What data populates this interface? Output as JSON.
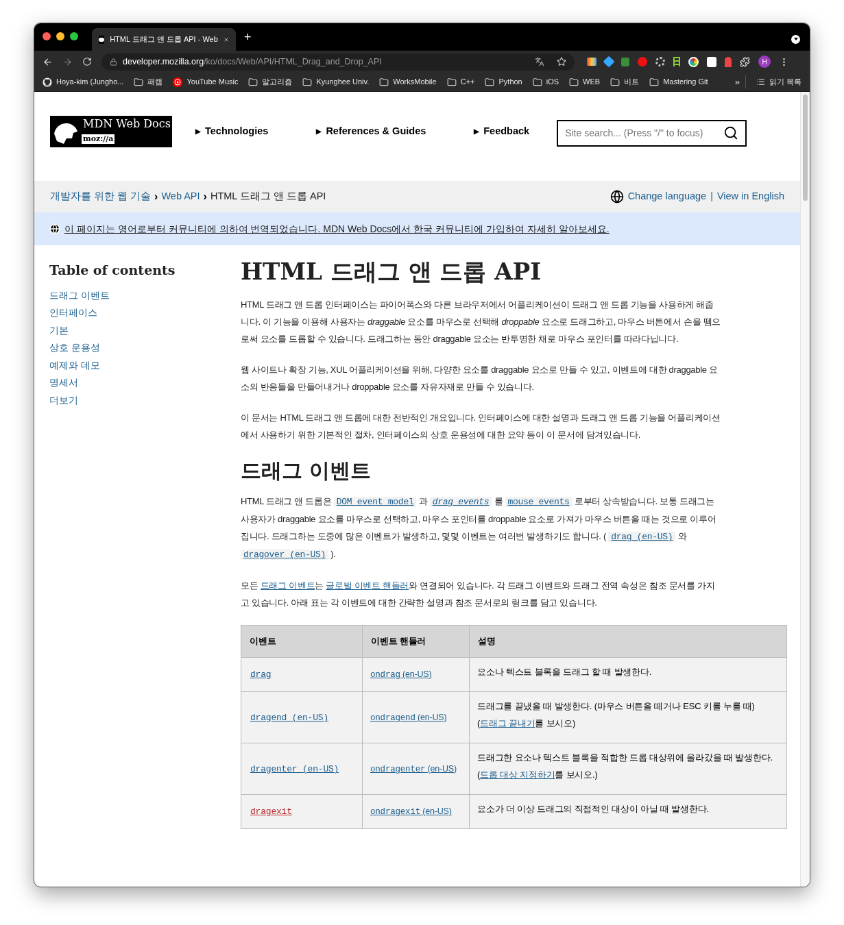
{
  "browser": {
    "tab_title": "HTML 드래그 앤 드롭 API - Web",
    "new_tab": "+",
    "url_host": "developer.mozilla.org",
    "url_path": "/ko/docs/Web/API/HTML_Drag_and_Drop_API",
    "profile": "H",
    "bookmarks": [
      {
        "label": "Hoya-kim (Jungho...",
        "kind": "github"
      },
      {
        "label": "패캠",
        "kind": "folder"
      },
      {
        "label": "YouTube Music",
        "kind": "youtube"
      },
      {
        "label": "알고리즘",
        "kind": "folder"
      },
      {
        "label": "Kyunghee Univ.",
        "kind": "folder"
      },
      {
        "label": "WorksMobile",
        "kind": "folder"
      },
      {
        "label": "C++",
        "kind": "folder"
      },
      {
        "label": "Python",
        "kind": "folder"
      },
      {
        "label": "iOS",
        "kind": "folder"
      },
      {
        "label": "WEB",
        "kind": "folder"
      },
      {
        "label": "비트",
        "kind": "folder"
      },
      {
        "label": "Mastering Git",
        "kind": "folder"
      }
    ],
    "more_bookmarks": "»",
    "reading_list": "읽기 목록"
  },
  "header": {
    "logo_title": "MDN Web Docs",
    "logo_sub": "moz://a",
    "nav": [
      "Technologies",
      "References & Guides",
      "Feedback"
    ],
    "nav_marker": "▶",
    "search": {
      "placeholder": "Site search... (Press \"/\" to focus)"
    }
  },
  "breadcrumbs": {
    "items": [
      "개발자를 위한 웹 기술",
      "Web API",
      "HTML 드래그 앤 드롭 API"
    ],
    "separator": "›",
    "change_language": "Change language",
    "divider": "|",
    "view_english": "View in English"
  },
  "notice": "이 페이지는 영어로부터 커뮤니티에 의하여 번역되었습니다. MDN Web Docs에서 한국 커뮤니티에 가입하여 자세히 알아보세요.",
  "toc": {
    "title": "Table of contents",
    "items": [
      "드래그 이벤트",
      "인터페이스",
      "기본",
      "상호 운용성",
      "예제와 데모",
      "명세서",
      "더보기"
    ]
  },
  "article": {
    "title": "HTML 드래그 앤 드롭 API",
    "intro": [
      "HTML 드래그 앤 드롭 인터페이스는 파이어폭스와 다른 브라우저에서 어플리케이션이 드래그 앤 드롭 기능을 사용하게 해줍니다. 이 기능을 이용해 사용자는 *draggable* 요소를 마우스로 선택해 *droppable* 요소로 드래그하고, 마우스 버튼에서 손을 뗌으로써 요소를 드롭할 수 있습니다. 드래그하는 동안 draggable 요소는 반투명한 채로 마우스 포인터를 따라다닙니다.",
      "웹 사이트나 확장 기능, XUL 어플리케이션을 위해, 다양한 요소를 draggable 요소로 만들 수 있고, 이벤트에 대한 draggable 요소의 반응들을 만들어내거나 droppable 요소를 자유자재로 만들 수 있습니다.",
      "이 문서는 HTML 드래그 앤 드롭에 대한 전반적인 개요입니다. 인터페이스에 대한 설명과 드래그 앤 드롭 기능을 어플리케이션에서 사용하기 위한 기본적인 절차, 인터페이스의 상호 운용성에 대한 요약 등이 이 문서에 담겨있습니다."
    ],
    "section_title": "드래그 이벤트",
    "section_paragraphs": [
      [
        {
          "kind": "text",
          "text": "HTML 드래그 앤 드롭은 "
        },
        {
          "kind": "code",
          "text": "DOM event model"
        },
        {
          "kind": "text",
          "text": " 과 "
        },
        {
          "kind": "code-italic",
          "text": "drag events"
        },
        {
          "kind": "text",
          "text": " 를 "
        },
        {
          "kind": "code",
          "text": "mouse events"
        },
        {
          "kind": "text",
          "text": " 로부터 상속받습니다. 보통 드래그는 사용자가 draggable 요소를 마우스로 선택하고, 마우스 포인터를 droppable 요소로 가져가 마우스 버튼을 때는 것으로 이루어집니다. 드래그하는 도중에 많은 이벤트가 발생하고, 몇몇 이벤트는 여러번 발생하기도 합니다. ( "
        },
        {
          "kind": "code",
          "text": "drag (en-US)"
        },
        {
          "kind": "text",
          "text": " 와 "
        },
        {
          "kind": "code",
          "text": "dragover (en-US)"
        },
        {
          "kind": "text",
          "text": " )."
        }
      ],
      [
        {
          "kind": "text",
          "text": "모든 "
        },
        {
          "kind": "link",
          "text": "드래그 이벤트"
        },
        {
          "kind": "text",
          "text": "는 "
        },
        {
          "kind": "link",
          "text": "글로벌 이벤트 핸들러"
        },
        {
          "kind": "text",
          "text": "와 연결되어 있습니다. 각 드래그 이벤트와 드래그 전역 속성은 참조 문서를 가지고 있습니다. 아래 표는 각 이벤트에 대한 간략한 설명과 참조 문서로의 링크를 담고 있습니다."
        }
      ]
    ],
    "table": {
      "columns": [
        "이벤트",
        "이벤트 핸들러",
        "설명"
      ],
      "rows": [
        {
          "event": "drag",
          "missing": false,
          "handler": "ondrag",
          "handler_note": "(en-US)",
          "description": [
            {
              "kind": "text",
              "text": "요소나 텍스트 블록을 드래그 할 때 발생한다."
            }
          ]
        },
        {
          "event": "dragend (en-US)",
          "missing": false,
          "handler": "ondragend",
          "handler_note": "(en-US)",
          "description": [
            {
              "kind": "text",
              "text": "드래그를 끝냈을 때 발생한다. (마우스 버튼을 떼거나 ESC 키를 누를 때) ("
            },
            {
              "kind": "link",
              "text": "드래그 끝내기"
            },
            {
              "kind": "text",
              "text": "를 보시오)"
            }
          ]
        },
        {
          "event": "dragenter (en-US)",
          "missing": false,
          "handler": "ondragenter",
          "handler_note": "(en-US)",
          "description": [
            {
              "kind": "text",
              "text": "드래그한 요소나 텍스트 블록을 적합한 드롭 대상위에 올라갔을 때 발생한다. ("
            },
            {
              "kind": "link",
              "text": "드롭 대상 지정하기"
            },
            {
              "kind": "text",
              "text": "를 보시오.)"
            }
          ]
        },
        {
          "event": "dragexit",
          "missing": true,
          "handler": "ondragexit",
          "handler_note": "(en-US)",
          "description": [
            {
              "kind": "text",
              "text": "요소가 더 이상 드래그의 직접적인 대상이 아닐 때 발생한다."
            }
          ]
        }
      ]
    }
  }
}
